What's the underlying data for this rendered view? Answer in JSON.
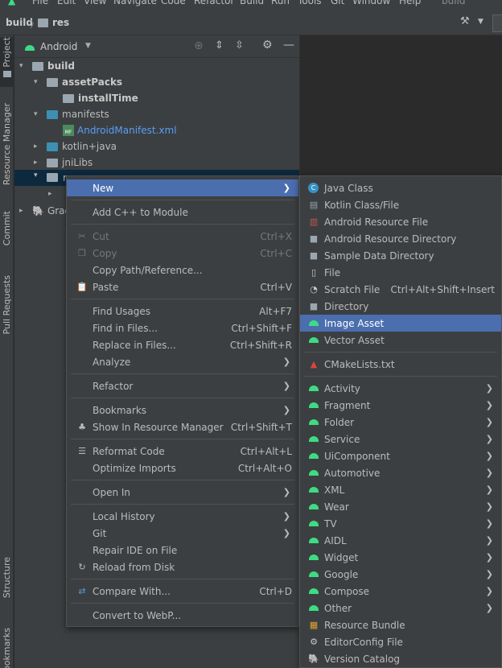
{
  "menubar": {
    "items": [
      "File",
      "Edit",
      "View",
      "Navigate",
      "Code",
      "Refactor",
      "Build",
      "Run",
      "Tools",
      "Git",
      "Window",
      "Help",
      "build"
    ]
  },
  "breadcrumb": {
    "root": "build",
    "child": "res"
  },
  "left_tabs": [
    "Project",
    "Resource Manager",
    "Commit",
    "Pull Requests",
    "Structure",
    "Bookmarks"
  ],
  "project_view": {
    "selector": "Android"
  },
  "tree": [
    {
      "label": "build"
    },
    {
      "label": "assetPacks"
    },
    {
      "label": "installTime"
    },
    {
      "label": "manifests"
    },
    {
      "label": "AndroidManifest.xml"
    },
    {
      "label": "kotlin+java"
    },
    {
      "label": "jniLibs"
    },
    {
      "label": "r"
    },
    {
      "label": "Grad"
    }
  ],
  "context_menu": [
    {
      "label": "New",
      "shortcut": ""
    },
    {
      "label": "Add C++ to Module",
      "shortcut": ""
    },
    {
      "label": "Cut",
      "shortcut": "Ctrl+X"
    },
    {
      "label": "Copy",
      "shortcut": "Ctrl+C"
    },
    {
      "label": "Copy Path/Reference...",
      "shortcut": ""
    },
    {
      "label": "Paste",
      "shortcut": "Ctrl+V"
    },
    {
      "label": "Find Usages",
      "shortcut": "Alt+F7"
    },
    {
      "label": "Find in Files...",
      "shortcut": "Ctrl+Shift+F"
    },
    {
      "label": "Replace in Files...",
      "shortcut": "Ctrl+Shift+R"
    },
    {
      "label": "Analyze",
      "shortcut": ""
    },
    {
      "label": "Refactor",
      "shortcut": ""
    },
    {
      "label": "Bookmarks",
      "shortcut": ""
    },
    {
      "label": "Show In Resource Manager",
      "shortcut": "Ctrl+Shift+T"
    },
    {
      "label": "Reformat Code",
      "shortcut": "Ctrl+Alt+L"
    },
    {
      "label": "Optimize Imports",
      "shortcut": "Ctrl+Alt+O"
    },
    {
      "label": "Open In",
      "shortcut": ""
    },
    {
      "label": "Local History",
      "shortcut": ""
    },
    {
      "label": "Git",
      "shortcut": ""
    },
    {
      "label": "Repair IDE on File",
      "shortcut": ""
    },
    {
      "label": "Reload from Disk",
      "shortcut": ""
    },
    {
      "label": "Compare With...",
      "shortcut": "Ctrl+D"
    },
    {
      "label": "Convert to WebP...",
      "shortcut": ""
    }
  ],
  "new_submenu": [
    {
      "label": "Java Class",
      "shortcut": ""
    },
    {
      "label": "Kotlin Class/File",
      "shortcut": ""
    },
    {
      "label": "Android Resource File",
      "shortcut": ""
    },
    {
      "label": "Android Resource Directory",
      "shortcut": ""
    },
    {
      "label": "Sample Data Directory",
      "shortcut": ""
    },
    {
      "label": "File",
      "shortcut": ""
    },
    {
      "label": "Scratch File",
      "shortcut": "Ctrl+Alt+Shift+Insert"
    },
    {
      "label": "Directory",
      "shortcut": ""
    },
    {
      "label": "Image Asset",
      "shortcut": ""
    },
    {
      "label": "Vector Asset",
      "shortcut": ""
    },
    {
      "label": "CMakeLists.txt",
      "shortcut": ""
    },
    {
      "label": "Activity",
      "shortcut": ""
    },
    {
      "label": "Fragment",
      "shortcut": ""
    },
    {
      "label": "Folder",
      "shortcut": ""
    },
    {
      "label": "Service",
      "shortcut": ""
    },
    {
      "label": "UiComponent",
      "shortcut": ""
    },
    {
      "label": "Automotive",
      "shortcut": ""
    },
    {
      "label": "XML",
      "shortcut": ""
    },
    {
      "label": "Wear",
      "shortcut": ""
    },
    {
      "label": "TV",
      "shortcut": ""
    },
    {
      "label": "AIDL",
      "shortcut": ""
    },
    {
      "label": "Widget",
      "shortcut": ""
    },
    {
      "label": "Google",
      "shortcut": ""
    },
    {
      "label": "Compose",
      "shortcut": ""
    },
    {
      "label": "Other",
      "shortcut": ""
    },
    {
      "label": "Resource Bundle",
      "shortcut": ""
    },
    {
      "label": "EditorConfig File",
      "shortcut": ""
    },
    {
      "label": "Version Catalog",
      "shortcut": ""
    }
  ],
  "colors": {
    "selection": "#4b6eaf",
    "panel": "#3c3f41",
    "editor": "#2b2b2b",
    "android_green": "#3ddc84",
    "kotlin_file_link": "#589df6"
  }
}
